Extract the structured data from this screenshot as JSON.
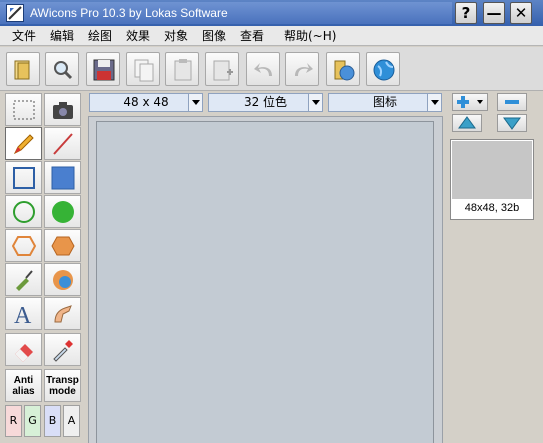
{
  "window": {
    "title": "AWicons Pro 10.3 by Lokas Software",
    "help_btn": "?",
    "min_btn": "—",
    "close_btn": "✕"
  },
  "menu": [
    "文件",
    "编辑",
    "绘图",
    "效果",
    "对象",
    "图像",
    "查看",
    "帮助(~H)"
  ],
  "toolbar": {
    "buttons": [
      "open-icon",
      "zoom-icon",
      "save-icon",
      "copy-icon",
      "paste-icon",
      "paste-new-icon",
      "undo-icon",
      "redo-icon",
      "library-icon",
      "web-icon"
    ]
  },
  "selectors": {
    "size": "48 x 48",
    "depth": "32 位色",
    "type": "图标"
  },
  "tools": {
    "antialias": "Anti alias",
    "transp": "Transp mode",
    "channels": [
      "R",
      "G",
      "B",
      "A"
    ]
  },
  "preview": {
    "label": "48x48, 32b"
  },
  "colors": {
    "title_bar": "#4a72bd",
    "canvas": "#c3cbd3",
    "accent": "#2f8fd8"
  }
}
